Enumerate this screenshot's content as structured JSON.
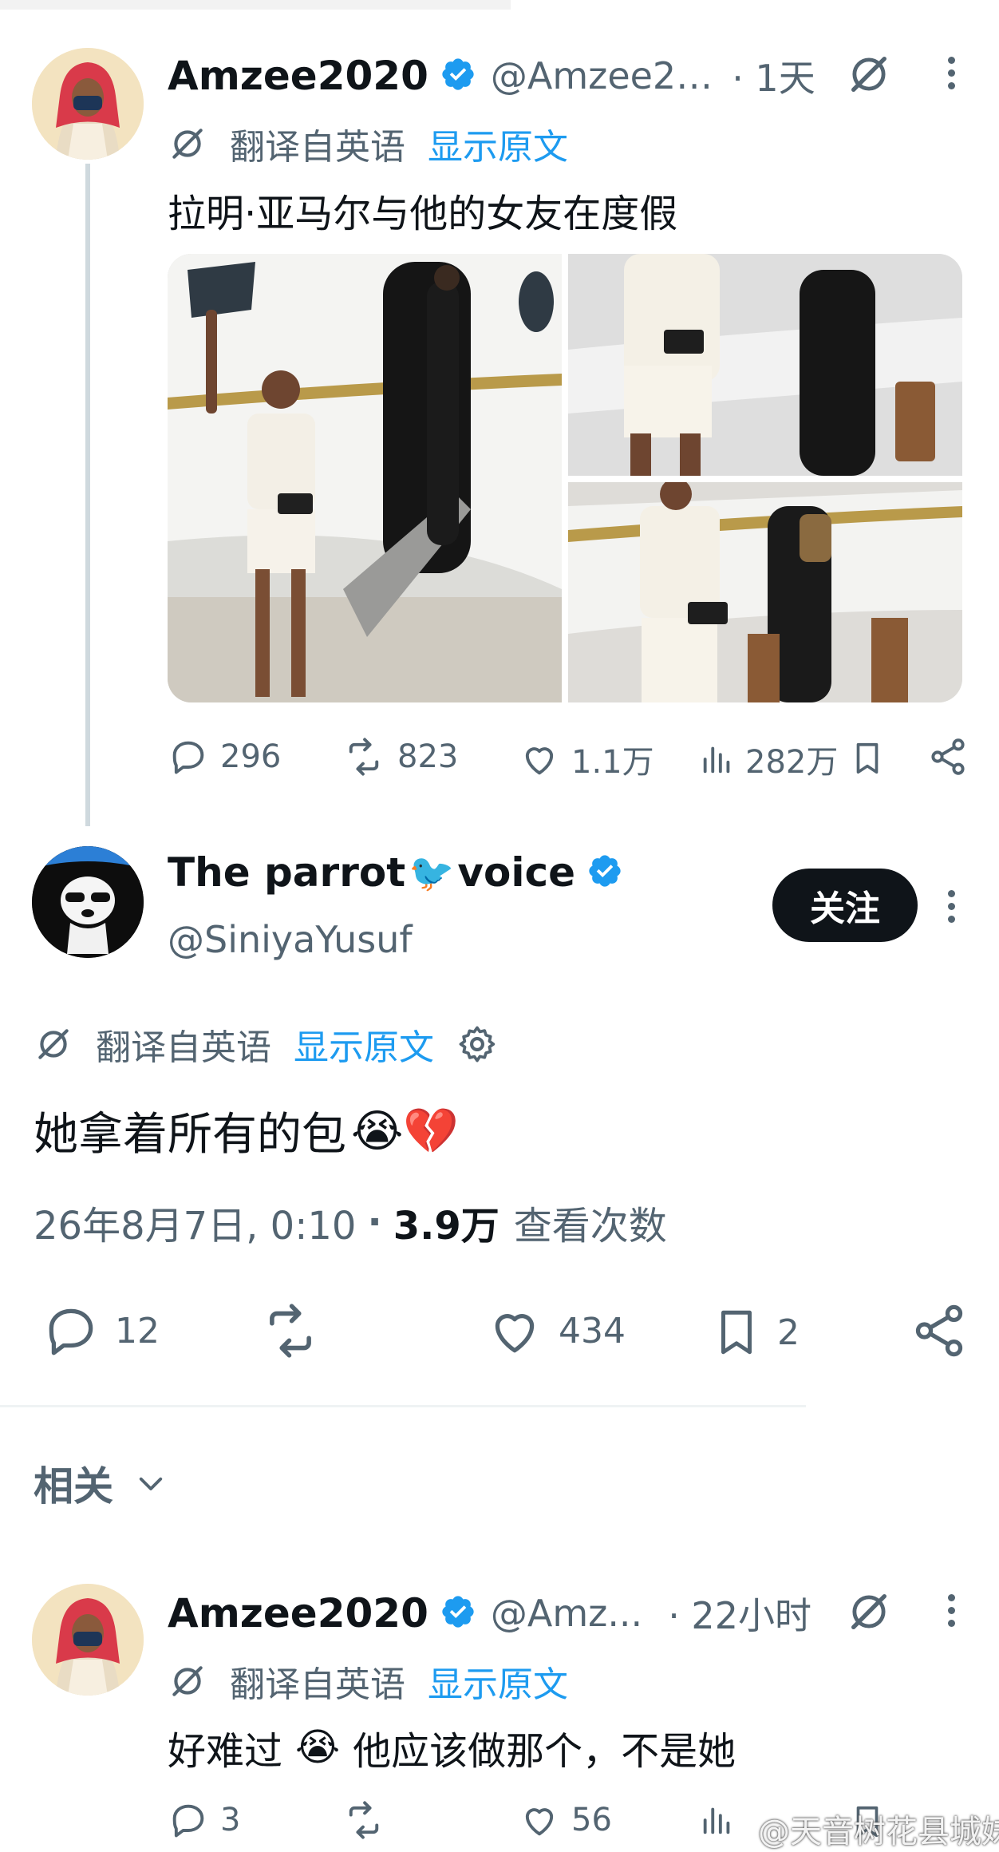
{
  "tweet1": {
    "name": "Amzee2020",
    "handle": "@Amzee2…",
    "time": "· 1天",
    "translated_from": "翻译自英语",
    "show_original": "显示原文",
    "text": "拉明·亚马尔与他的女友在度假",
    "actions": {
      "replies": "296",
      "retweets": "823",
      "likes": "1.1万",
      "views": "282万"
    }
  },
  "tweet2": {
    "name_part1": "The parrot",
    "name_emoji": "🐦",
    "name_part2": "voice",
    "handle": "@SiniyaYusuf",
    "follow_label": "关注",
    "translated_from": "翻译自英语",
    "show_original": "显示原文",
    "text": "她拿着所有的包",
    "text_emojis": "😭💔",
    "date": "26年8月7日, 0:10",
    "dot": "·",
    "views_count": "3.9万",
    "views_label": "查看次数",
    "actions": {
      "replies": "12",
      "likes": "434",
      "bookmarks": "2"
    }
  },
  "related": {
    "label": "相关"
  },
  "tweet3": {
    "name": "Amzee2020",
    "handle": "@Amz...",
    "time": "· 22小时",
    "translated_from": "翻译自英语",
    "show_original": "显示原文",
    "text_part1": "好难过",
    "text_emoji": "😭",
    "text_part2": "他应该做那个，不是她",
    "actions": {
      "replies": "3",
      "likes": "56"
    }
  },
  "watermark": "@天音树花县城妹",
  "colors": {
    "accent": "#1d9bf0",
    "text": "#0f1419",
    "muted": "#536471"
  }
}
